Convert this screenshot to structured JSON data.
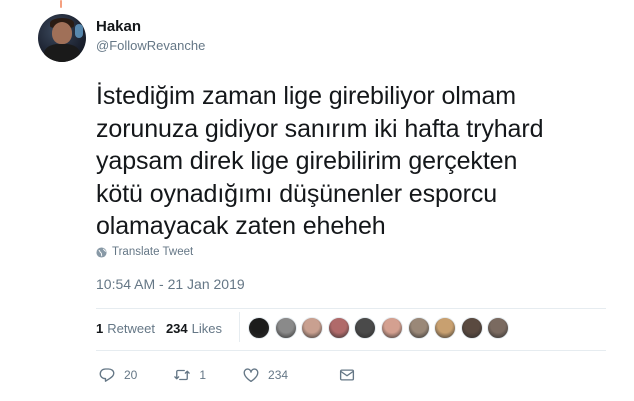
{
  "author": {
    "display_name": "Hakan",
    "handle": "@FollowRevanche"
  },
  "tweet": {
    "lines": [
      "İstediğim zaman lige girebiliyor olmam",
      "zorunuza gidiyor sanırım iki hafta tryhard",
      "yapsam direk lige girebilirim gerçekten",
      "kötü oynadığımı düşünenler esporcu",
      "olamayacak zaten eheheh"
    ],
    "translate_label": "Translate Tweet",
    "timestamp": "10:54 AM - 21 Jan 2019"
  },
  "stats": {
    "retweets_count": "1",
    "retweets_label": "Retweet",
    "likes_count": "234",
    "likes_label": "Likes"
  },
  "actions": {
    "reply_count": "20",
    "retweet_count": "1",
    "like_count": "234"
  },
  "liker_avatar_colors": [
    "#1c1c1c",
    "#8a8a8a",
    "#c9a090",
    "#b06a6a",
    "#4a4a4a",
    "#d4a090",
    "#9a8878",
    "#c8a070",
    "#5a4a40",
    "#7a6a60"
  ],
  "colors": {
    "text": "#14171a",
    "secondary": "#657786",
    "divider": "#e6ecf0"
  }
}
